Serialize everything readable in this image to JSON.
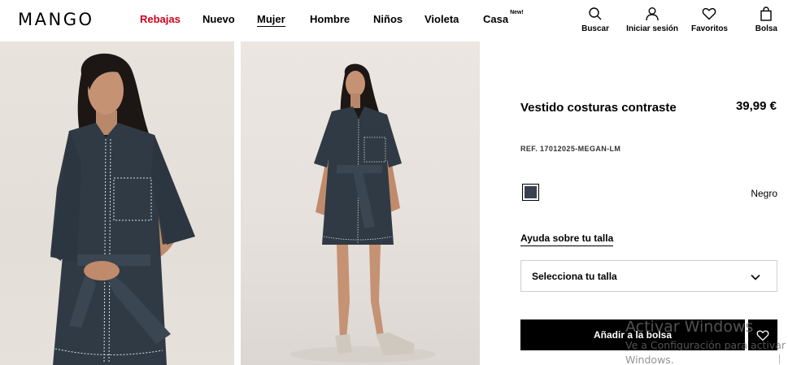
{
  "header": {
    "logo": "MANGO",
    "nav": [
      {
        "label": "Rebajas",
        "sale": true
      },
      {
        "label": "Nuevo"
      },
      {
        "label": "Mujer",
        "active": true
      },
      {
        "label": "Hombre"
      },
      {
        "label": "Niños"
      },
      {
        "label": "Violeta"
      },
      {
        "label": "Casa",
        "badge": "New!"
      }
    ],
    "tools": {
      "search": {
        "label": "Buscar",
        "icon": "search-icon"
      },
      "login": {
        "label": "Iniciar sesión",
        "icon": "user-icon"
      },
      "favorites": {
        "label": "Favoritos",
        "icon": "heart-icon"
      },
      "bag": {
        "label": "Bolsa",
        "icon": "bag-icon"
      }
    }
  },
  "product": {
    "title": "Vestido costuras contraste",
    "price": "39,99 €",
    "ref": "REF. 17012025-MEGAN-LM",
    "color": {
      "name": "Negro",
      "swatch": "#3a4150"
    },
    "size_help": "Ayuda sobre tu talla",
    "size_select": {
      "label": "Selecciona tu talla",
      "icon": "chevron-down-icon"
    },
    "add_to_bag": "Añadir a la bolsa",
    "favorite_icon": "heart-icon"
  },
  "images": [
    {
      "name": "product-photo-front-closeup"
    },
    {
      "name": "product-photo-full-body"
    }
  ],
  "watermark": {
    "title": "Activar Windows",
    "line1": "Ve a Configuración para activar",
    "line2": "Windows."
  },
  "colors": {
    "sale": "#d0021b",
    "dress": "#2f3a44",
    "background": "#e8e2dc"
  }
}
